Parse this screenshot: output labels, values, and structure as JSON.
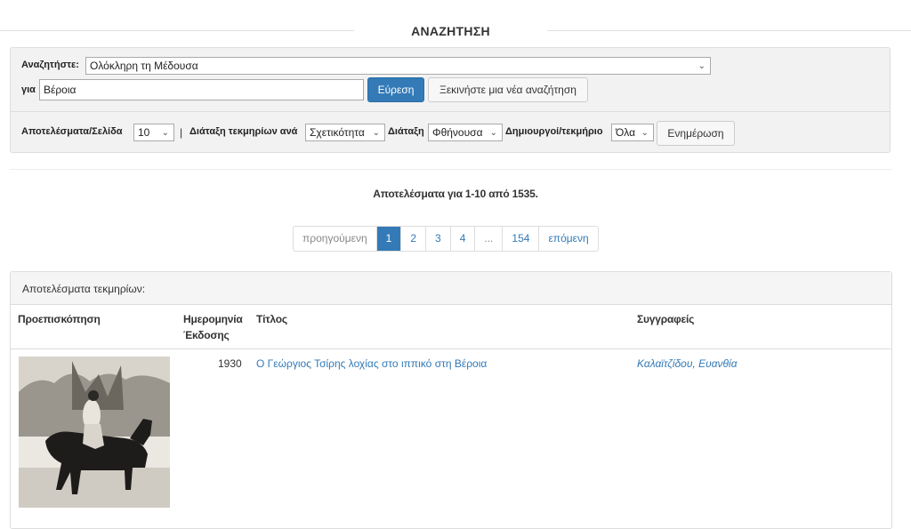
{
  "page": {
    "title": "ΑΝΑΖΗΤΗΣΗ"
  },
  "search": {
    "scope_label": "Αναζητήστε:",
    "scope_value": "Ολόκληρη τη Μέδουσα",
    "query_label": "για",
    "query_value": "Βέροια",
    "find_button": "Εύρεση",
    "new_search_button": "Ξεκινήστε μια νέα αναζήτηση"
  },
  "options": {
    "rpp_label": "Αποτελέσματα/Σελίδα",
    "rpp_value": "10",
    "pipe": "|",
    "sort_by_label": "Διάταξη τεκμηρίων ανά",
    "sort_by_value": "Σχετικότητα",
    "order_label": "Διάταξη",
    "order_value": "Φθήνουσα",
    "authors_label": "Δημιουργοί/τεκμήριο",
    "authors_value": "Όλα",
    "update_button": "Ενημέρωση"
  },
  "results": {
    "summary": "Αποτελέσματα για 1-10 από 1535."
  },
  "pagination": {
    "prev": "προηγούμενη",
    "pages": [
      "1",
      "2",
      "3",
      "4",
      "...",
      "154"
    ],
    "active": "1",
    "next": "επόμενη"
  },
  "items_panel": {
    "heading": "Αποτελέσματα τεκμηρίων:",
    "columns": {
      "preview": "Προεπισκόπηση",
      "date_line1": "Ημερομηνία",
      "date_line2": "Έκδοσης",
      "title": "Τίτλος",
      "authors": "Συγγραφείς"
    },
    "rows": [
      {
        "year": "1930",
        "title": "Ο Γεώργιος Τσίρης λοχίας στο ιππικό στη Βέροια",
        "author": "Καλαϊτζίδου, Ευανθία"
      }
    ]
  },
  "colors": {
    "accent": "#337ab7",
    "panel_bg": "#f2f2f2"
  }
}
